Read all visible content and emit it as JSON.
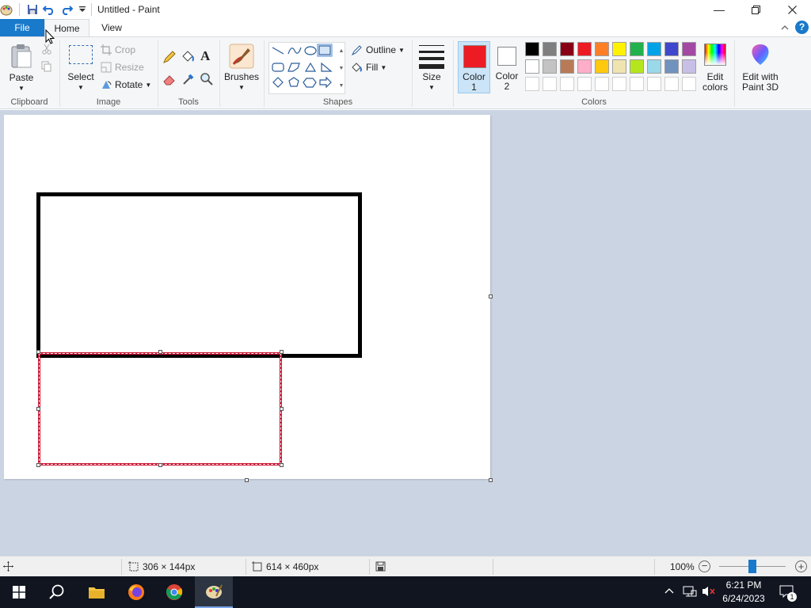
{
  "window": {
    "title": "Untitled - Paint",
    "minimize_icon": "minimize-icon",
    "maximize_icon": "restore-icon",
    "close_icon": "close-icon"
  },
  "quick_access": [
    "paint-app-icon",
    "save-icon",
    "undo-icon",
    "redo-icon",
    "customize-dropdown-icon"
  ],
  "tabs": {
    "file": "File",
    "home": "Home",
    "view": "View"
  },
  "ribbon": {
    "clipboard": {
      "label": "Clipboard",
      "paste": "Paste"
    },
    "image": {
      "label": "Image",
      "select": "Select",
      "crop": "Crop",
      "resize": "Resize",
      "rotate": "Rotate"
    },
    "tools": {
      "label": "Tools"
    },
    "brushes": "Brushes",
    "shapes": {
      "label": "Shapes",
      "outline": "Outline",
      "fill": "Fill"
    },
    "size": "Size",
    "color1": {
      "line1": "Color",
      "line2": "1",
      "value": "#ed1c24"
    },
    "color2": {
      "line1": "Color",
      "line2": "2",
      "value": "#ffffff"
    },
    "colors": {
      "label": "Colors",
      "edit_line1": "Edit",
      "edit_line2": "colors",
      "palette_row1": [
        "#000000",
        "#7f7f7f",
        "#880015",
        "#ed1c24",
        "#ff7f27",
        "#fff200",
        "#22b14c",
        "#00a2e8",
        "#3f48cc",
        "#a349a4"
      ],
      "palette_row2": [
        "#ffffff",
        "#c3c3c3",
        "#b97a57",
        "#ffaec9",
        "#ffc90e",
        "#efe4b0",
        "#b5e61d",
        "#99d9ea",
        "#7092be",
        "#c8bfe7"
      ]
    },
    "paint3d_line1": "Edit with",
    "paint3d_line2": "Paint 3D",
    "help_icon": "help-icon"
  },
  "status": {
    "selection_size": "306 × 144px",
    "canvas_size": "614 × 460px",
    "zoom": "100%",
    "zoom_level": 1.0
  },
  "taskbar": {
    "time": "6:21 PM",
    "date": "6/24/2023",
    "notification_count": "1"
  },
  "colors": {
    "file_tab": "#1979ca",
    "selection_outline": "#c8102e",
    "canvas_background": "#cad4e3"
  }
}
